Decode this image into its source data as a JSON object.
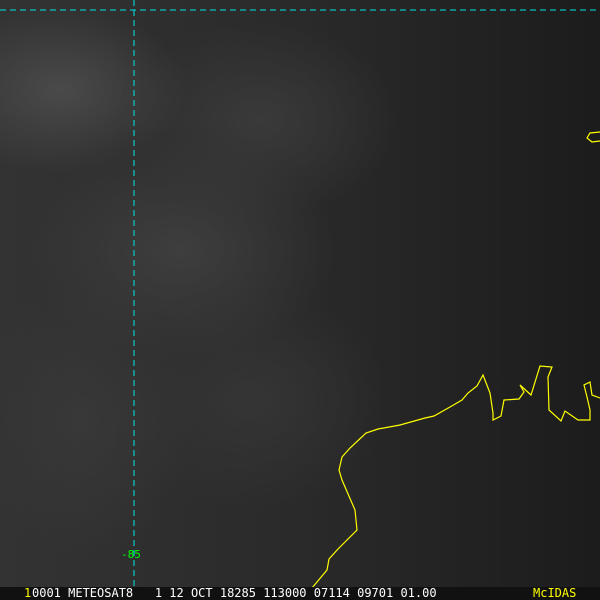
{
  "image": {
    "frame_number": "1",
    "info_line": "0001 METEOSAT8   1 12 OCT 18285 113000 07114 09701 01.00",
    "brand": "McIDAS",
    "longitude_label": "-85",
    "colors": {
      "coast": "#ffff00",
      "grid": "#00e5e5",
      "label": "#00ff00"
    }
  }
}
